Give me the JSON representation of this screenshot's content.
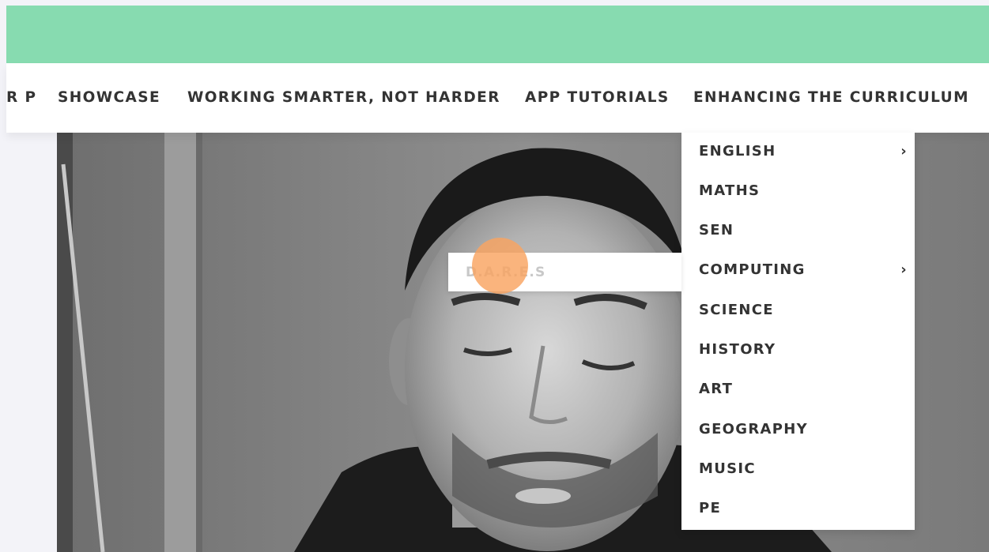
{
  "nav": {
    "items": [
      {
        "label": "R P"
      },
      {
        "label": "SHOWCASE"
      },
      {
        "label": "WORKING SMARTER, NOT HARDER"
      },
      {
        "label": "APP TUTORIALS"
      },
      {
        "label": "ENHANCING THE CURRICULUM"
      }
    ]
  },
  "dropdown": {
    "items": [
      {
        "label": "ENGLISH",
        "arrow": "›"
      },
      {
        "label": "MATHS"
      },
      {
        "label": "SEN"
      },
      {
        "label": "COMPUTING",
        "arrow": "›"
      },
      {
        "label": "SCIENCE"
      },
      {
        "label": "HISTORY"
      },
      {
        "label": "ART"
      },
      {
        "label": "GEOGRAPHY"
      },
      {
        "label": "MUSIC"
      },
      {
        "label": "PE"
      }
    ]
  },
  "submenu": {
    "items": [
      {
        "label": "D.A.R.E.S"
      }
    ]
  },
  "colors": {
    "header_green": "#87dbb0",
    "nav_text": "#333333",
    "cursor_highlight": "#f9a360"
  }
}
